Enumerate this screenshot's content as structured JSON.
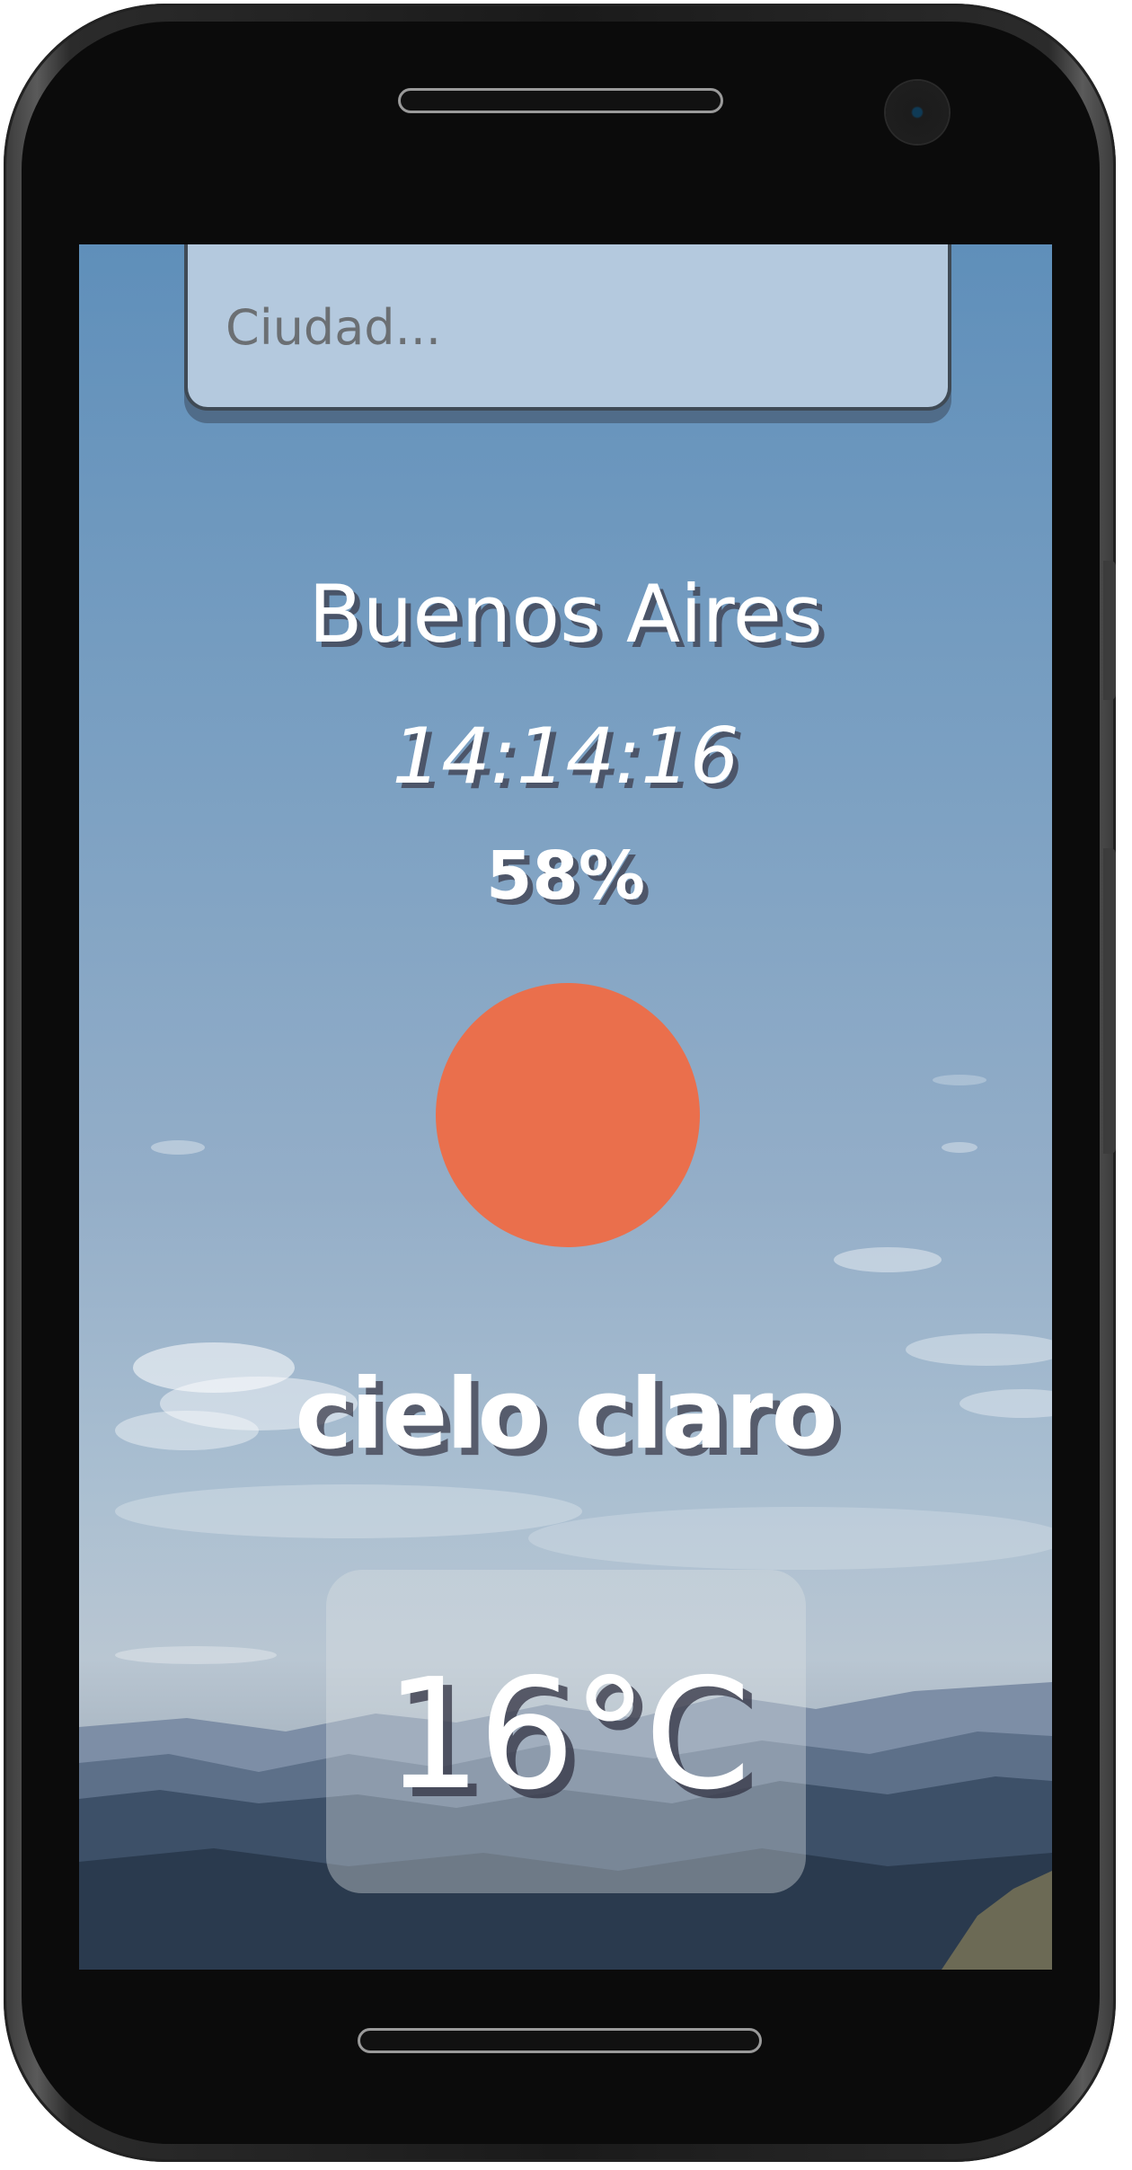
{
  "search": {
    "placeholder": "Ciudad..."
  },
  "weather": {
    "city": "Buenos Aires",
    "time": "14:14:16",
    "humidity": "58%",
    "description": "cielo claro",
    "temperature": "16°C",
    "icon": "sun-icon"
  },
  "colors": {
    "sun": "#ea6f4c",
    "search_background": "#b4c9de",
    "sky_top": "#5f8fba",
    "text": "#ffffff"
  }
}
